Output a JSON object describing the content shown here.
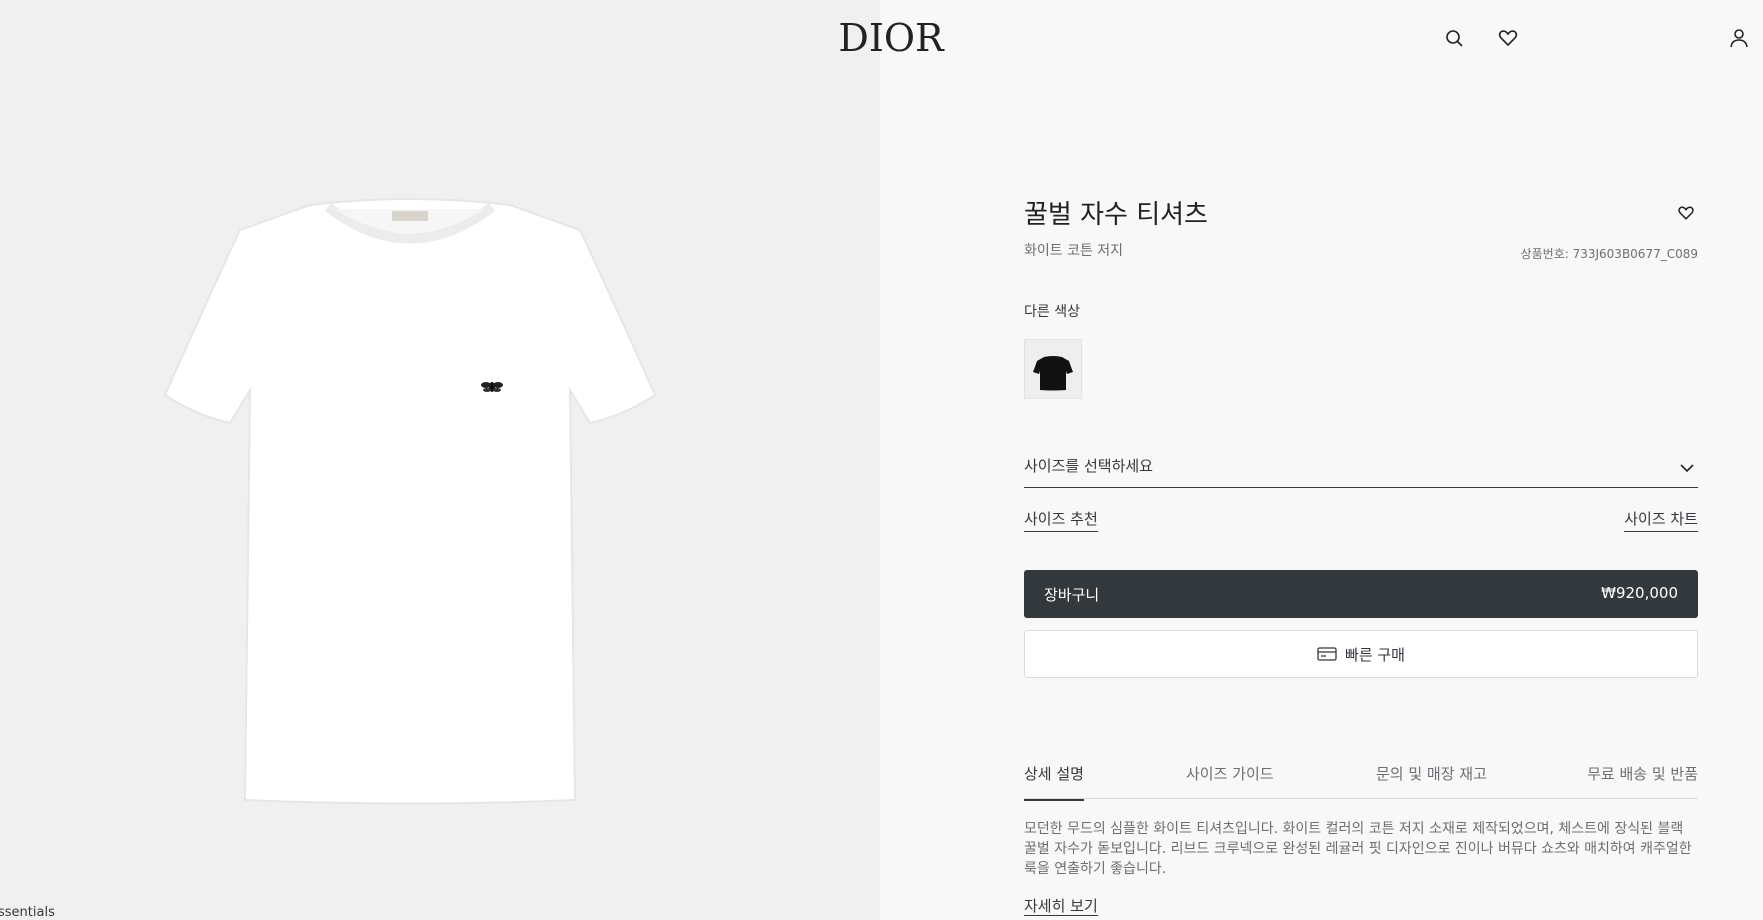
{
  "header": {
    "logo": "DIOR",
    "icons": [
      "search-icon",
      "heart-icon",
      "user-icon"
    ]
  },
  "image_panel": {
    "collection_label": "ssentials"
  },
  "product": {
    "title": "꿀벌 자수 티셔츠",
    "subtitle": "화이트 코튼 저지",
    "reference": "상품번호: 733J603B0677_C089",
    "other_colors_label": "다른 색상",
    "size_select_placeholder": "사이즈를 선택하세요",
    "size_recommend_link": "사이즈 추천",
    "size_chart_link": "사이즈 차트",
    "cart_label": "장바구니",
    "price": "₩920,000",
    "quick_buy_label": "빠른 구매"
  },
  "tabs": [
    {
      "label": "상세 설명",
      "active": true
    },
    {
      "label": "사이즈 가이드",
      "active": false
    },
    {
      "label": "문의 및 매장 재고",
      "active": false
    },
    {
      "label": "무료 배송 및 반품",
      "active": false
    }
  ],
  "description": {
    "text": "모던한 무드의 심플한 화이트 티셔츠입니다. 화이트 컬러의 코튼 저지 소재로 제작되었으며, 체스트에 장식된 블랙 꿀벌 자수가 돋보입니다. 리브드 크루넥으로 완성된 레귤러 핏 디자인으로 진이나 버뮤다 쇼츠와 매치하여 캐주얼한 룩을 연출하기 좋습니다.",
    "more_link": "자세히 보기"
  },
  "colors": {
    "page_bg": "#f8f8f8",
    "image_bg": "#f0f0f0",
    "button_dark": "#33383c"
  }
}
